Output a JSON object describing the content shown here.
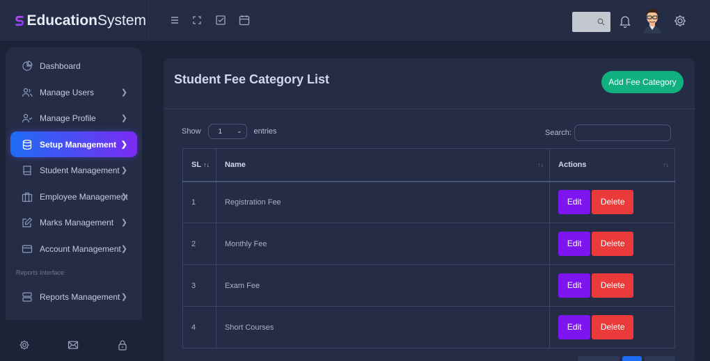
{
  "brand": {
    "name_bold": "Education",
    "name_rest": "System"
  },
  "header": {
    "icons": [
      "menu-icon",
      "fullscreen-icon",
      "checkbox-icon",
      "calendar-icon"
    ],
    "right_icons": [
      "search-icon",
      "bell-icon",
      "avatar",
      "gear-icon"
    ]
  },
  "sidebar": {
    "items": [
      {
        "label": "Dashboard",
        "icon": "pie-chart-icon",
        "chevron": false
      },
      {
        "label": "Manage Users",
        "icon": "users-icon",
        "chevron": true
      },
      {
        "label": "Manage Profile",
        "icon": "user-check-icon",
        "chevron": true
      },
      {
        "label": "Setup Management",
        "icon": "database-icon",
        "chevron": true,
        "active": true
      },
      {
        "label": "Student Management",
        "icon": "book-icon",
        "chevron": true
      },
      {
        "label": "Employee Management",
        "icon": "briefcase-icon",
        "chevron": true
      },
      {
        "label": "Marks Management",
        "icon": "edit-icon",
        "chevron": true
      },
      {
        "label": "Account Management",
        "icon": "credit-card-icon",
        "chevron": true
      }
    ],
    "section_header": "Reports Interface",
    "report_items": [
      {
        "label": "Reports Management",
        "icon": "server-icon",
        "chevron": true
      }
    ],
    "footer_icons": [
      "settings-icon",
      "mail-icon",
      "lock-icon"
    ]
  },
  "card": {
    "title": "Student Fee Category List",
    "add_button": "Add Fee Category"
  },
  "table_controls": {
    "show_label": "Show",
    "entries_value": "1",
    "entries_label": "entries",
    "search_label": "Search:"
  },
  "table": {
    "headers": {
      "sl": "SL",
      "name": "Name",
      "actions": "Actions"
    },
    "rows": [
      {
        "sl": "1",
        "name": "Registration Fee"
      },
      {
        "sl": "2",
        "name": "Monthly Fee"
      },
      {
        "sl": "3",
        "name": "Exam Fee"
      },
      {
        "sl": "4",
        "name": "Short Courses"
      }
    ],
    "edit_label": "Edit",
    "delete_label": "Delete"
  },
  "colors": {
    "accent_gradient_start": "#1e6cf5",
    "accent_gradient_end": "#7a2cf3",
    "add_button": "#10b17e",
    "edit_button": "#7c15f0",
    "delete_button": "#ea3a3a"
  }
}
